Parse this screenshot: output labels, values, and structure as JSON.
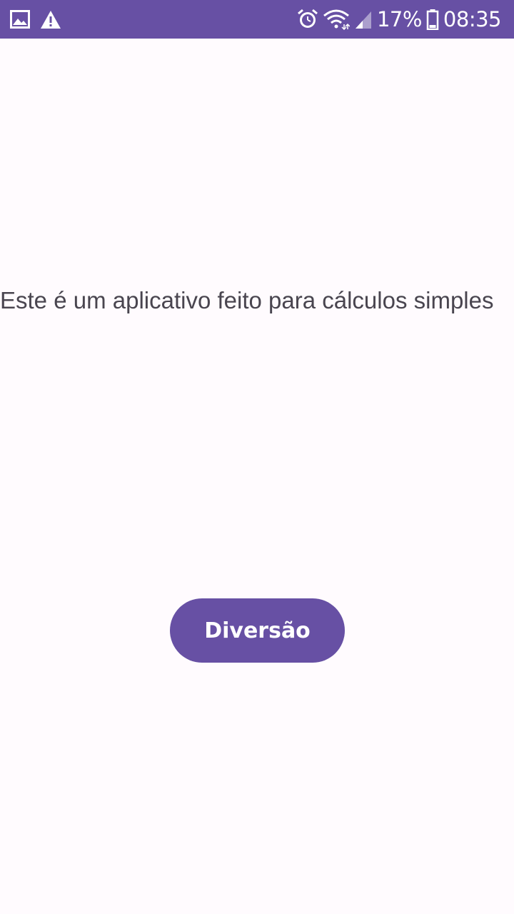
{
  "status_bar": {
    "background": "#6750a4",
    "left_icons": [
      "image-icon",
      "warning-icon"
    ],
    "right_icons": [
      "alarm-icon",
      "wifi-icon",
      "signal-icon",
      "battery-icon"
    ],
    "battery_percent": "17%",
    "time": "08:35"
  },
  "main": {
    "description": "Este é um aplicativo feito para cálculos simples",
    "fun_button_label": "Diversão"
  },
  "colors": {
    "accent": "#6750a4",
    "background": "#fffbfe",
    "text": "#49454f"
  }
}
